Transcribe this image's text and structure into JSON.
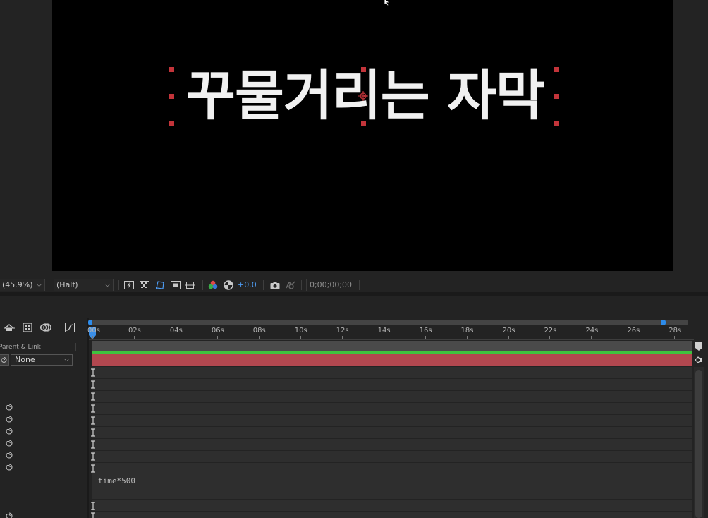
{
  "viewer": {
    "comp_text": "꾸물거리는 자막"
  },
  "toolbar": {
    "zoom_value": "(45.9%)",
    "resolution_value": "(Half)",
    "exposure_value": "+0.0",
    "timecode": "0;00;00;00"
  },
  "timeline": {
    "parent_link_header": "Parent & Link",
    "parent_value": "None",
    "expression": "time*500",
    "ruler_ticks": [
      "00s",
      "02s",
      "04s",
      "06s",
      "08s",
      "10s",
      "12s",
      "14s",
      "16s",
      "18s",
      "20s",
      "22s",
      "24s",
      "26s",
      "28s"
    ]
  },
  "colors": {
    "layer_bar": "#b2474f",
    "accent_blue": "#2d8ceb",
    "handle_red": "#c3343a",
    "green_line": "#3ec23e"
  },
  "icons": {
    "cursor": "arrow-cursor-icon",
    "anchor": "anchor-point-icon",
    "pickwhip": "spiral-pickwhip-icon"
  }
}
